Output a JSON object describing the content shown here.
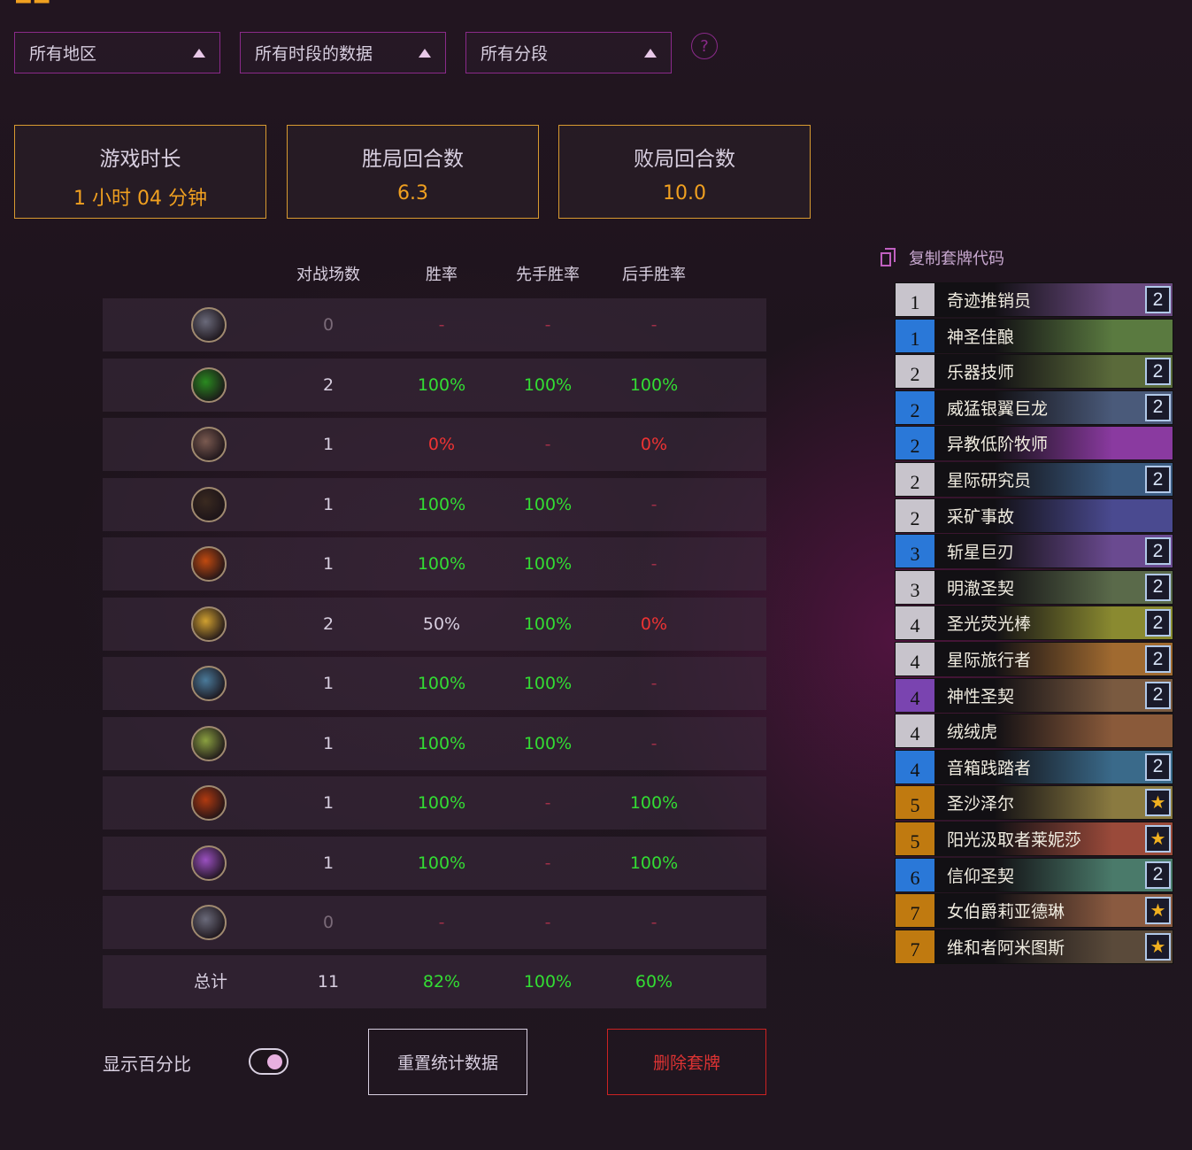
{
  "filters": [
    {
      "value": "所有地区"
    },
    {
      "value": "所有时段的数据"
    },
    {
      "value": "所有分段"
    }
  ],
  "stats": [
    {
      "label": "游戏时长",
      "value": "1 小时 04 分钟"
    },
    {
      "label": "胜局回合数",
      "value": "6.3"
    },
    {
      "label": "败局回合数",
      "value": "10.0"
    }
  ],
  "table": {
    "headers": [
      "对战场数",
      "胜率",
      "先手胜率",
      "后手胜率"
    ],
    "rows": [
      {
        "class_icon": "death-knight-icon",
        "games": "0",
        "win": "-",
        "first": "-",
        "second": "-",
        "state": [
          "dim",
          "dash-red",
          "dash-red",
          "dash-red"
        ],
        "color": "#6a6a7a"
      },
      {
        "class_icon": "demon-hunter-icon",
        "games": "2",
        "win": "100%",
        "first": "100%",
        "second": "100%",
        "state": [
          "neutral",
          "green",
          "green",
          "green"
        ],
        "color": "#2a8a20"
      },
      {
        "class_icon": "druid-icon",
        "games": "1",
        "win": "0%",
        "first": "-",
        "second": "0%",
        "state": [
          "neutral",
          "red",
          "dash-red",
          "red"
        ],
        "color": "#7a5a50"
      },
      {
        "class_icon": "hunter-icon",
        "games": "1",
        "win": "100%",
        "first": "100%",
        "second": "-",
        "state": [
          "neutral",
          "green",
          "green",
          "dash-red"
        ],
        "color": "#3a2a20"
      },
      {
        "class_icon": "mage-icon",
        "games": "1",
        "win": "100%",
        "first": "100%",
        "second": "-",
        "state": [
          "neutral",
          "green",
          "green",
          "dash-red"
        ],
        "color": "#c04a10"
      },
      {
        "class_icon": "paladin-icon",
        "games": "2",
        "win": "50%",
        "first": "100%",
        "second": "0%",
        "state": [
          "neutral",
          "neutral",
          "green",
          "red"
        ],
        "color": "#d0a030"
      },
      {
        "class_icon": "priest-icon",
        "games": "1",
        "win": "100%",
        "first": "100%",
        "second": "-",
        "state": [
          "neutral",
          "green",
          "green",
          "dash-red"
        ],
        "color": "#4a7a9a"
      },
      {
        "class_icon": "rogue-icon",
        "games": "1",
        "win": "100%",
        "first": "100%",
        "second": "-",
        "state": [
          "neutral",
          "green",
          "green",
          "dash-red"
        ],
        "color": "#8aa040"
      },
      {
        "class_icon": "shaman-icon",
        "games": "1",
        "win": "100%",
        "first": "-",
        "second": "100%",
        "state": [
          "neutral",
          "green",
          "dash-red",
          "green"
        ],
        "color": "#b03a10"
      },
      {
        "class_icon": "warlock-icon",
        "games": "1",
        "win": "100%",
        "first": "-",
        "second": "100%",
        "state": [
          "neutral",
          "green",
          "dash-red",
          "green"
        ],
        "color": "#9a50c0"
      },
      {
        "class_icon": "warrior-icon",
        "games": "0",
        "win": "-",
        "first": "-",
        "second": "-",
        "state": [
          "dim",
          "dash-red",
          "dash-red",
          "dash-red"
        ],
        "color": "#6a6a7a"
      }
    ],
    "total": {
      "label": "总计",
      "games": "11",
      "win": "82%",
      "first": "100%",
      "second": "60%"
    }
  },
  "controls": {
    "show_percent_label": "显示百分比",
    "reset_label": "重置统计数据",
    "delete_label": "删除套牌"
  },
  "deck": {
    "copy_label": "复制套牌代码",
    "cards": [
      {
        "cost": "1",
        "name": "奇迹推销员",
        "count": "2",
        "rarity": "neutral-c",
        "art": "#6a4a80"
      },
      {
        "cost": "1",
        "name": "神圣佳酿",
        "count": "",
        "rarity": "blue-c",
        "art": "#5a7a40"
      },
      {
        "cost": "2",
        "name": "乐器技师",
        "count": "2",
        "rarity": "neutral-c",
        "art": "#5a6a3a"
      },
      {
        "cost": "2",
        "name": "威猛银翼巨龙",
        "count": "2",
        "rarity": "blue-c",
        "art": "#4a5a7a"
      },
      {
        "cost": "2",
        "name": "异教低阶牧师",
        "count": "",
        "rarity": "blue-c",
        "art": "#8a3aa0"
      },
      {
        "cost": "2",
        "name": "星际研究员",
        "count": "2",
        "rarity": "neutral-c",
        "art": "#3a5a80"
      },
      {
        "cost": "2",
        "name": "采矿事故",
        "count": "",
        "rarity": "neutral-c",
        "art": "#4a4a90"
      },
      {
        "cost": "3",
        "name": "斩星巨刃",
        "count": "2",
        "rarity": "blue-c",
        "art": "#6a4a90"
      },
      {
        "cost": "3",
        "name": "明澈圣契",
        "count": "2",
        "rarity": "neutral-c",
        "art": "#5a6a4a"
      },
      {
        "cost": "4",
        "name": "圣光荧光棒",
        "count": "2",
        "rarity": "neutral-c",
        "art": "#8a8a30"
      },
      {
        "cost": "4",
        "name": "星际旅行者",
        "count": "2",
        "rarity": "neutral-c",
        "art": "#a06a30"
      },
      {
        "cost": "4",
        "name": "神性圣契",
        "count": "2",
        "rarity": "purple-c",
        "art": "#7a5a40"
      },
      {
        "cost": "4",
        "name": "绒绒虎",
        "count": "",
        "rarity": "neutral-c",
        "art": "#8a5a3a"
      },
      {
        "cost": "4",
        "name": "音箱践踏者",
        "count": "2",
        "rarity": "blue-c",
        "art": "#3a6a8a"
      },
      {
        "cost": "5",
        "name": "圣沙泽尔",
        "count": "★",
        "rarity": "gold-c",
        "art": "#8a7a40"
      },
      {
        "cost": "5",
        "name": "阳光汲取者莱妮莎",
        "count": "★",
        "rarity": "gold-c",
        "art": "#9a4a3a"
      },
      {
        "cost": "6",
        "name": "信仰圣契",
        "count": "2",
        "rarity": "blue-c",
        "art": "#4a7a6a"
      },
      {
        "cost": "7",
        "name": "女伯爵莉亚德琳",
        "count": "★",
        "rarity": "gold-c",
        "art": "#8a5a40"
      },
      {
        "cost": "7",
        "name": "维和者阿米图斯",
        "count": "★",
        "rarity": "gold-c",
        "art": "#5a4a3a"
      }
    ]
  },
  "colors": {
    "accent_orange": "#f0a020",
    "border_purple": "#8a2a8a",
    "win_green": "#33dd33",
    "loss_red": "#ee3333"
  }
}
